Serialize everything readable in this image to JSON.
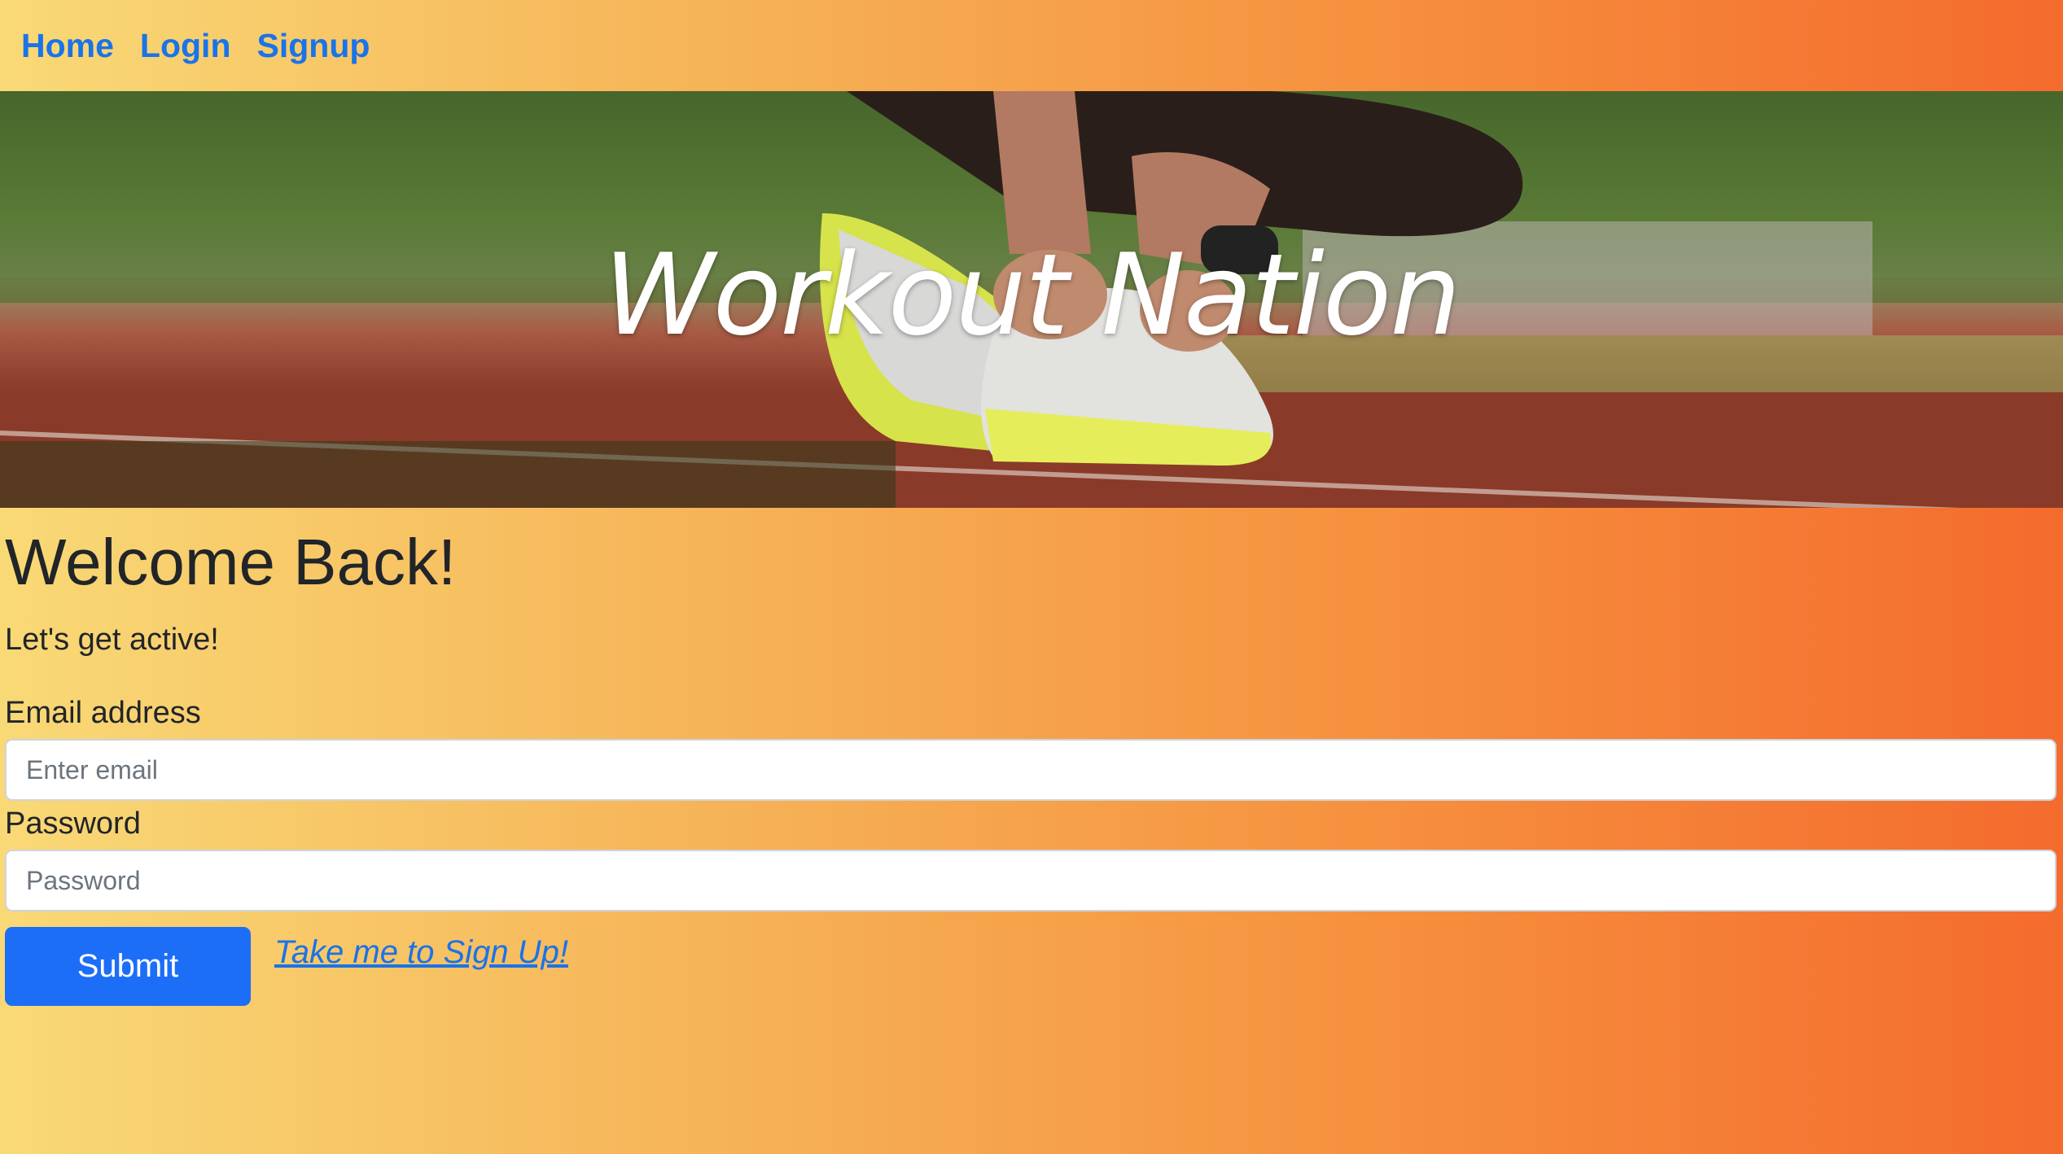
{
  "nav": {
    "items": [
      {
        "label": "Home"
      },
      {
        "label": "Login"
      },
      {
        "label": "Signup"
      }
    ]
  },
  "hero": {
    "title": "Workout Nation",
    "image_subject": "runner tying running shoes on a red track"
  },
  "main": {
    "heading": "Welcome Back!",
    "subheading": "Let's get active!"
  },
  "form": {
    "email_label": "Email address",
    "email_placeholder": "Enter email",
    "email_value": "",
    "password_label": "Password",
    "password_placeholder": "Password",
    "password_value": "",
    "submit_label": "Submit",
    "signup_link": "Take me to Sign Up!"
  },
  "colors": {
    "link": "#1a73e8",
    "button": "#1d6ef7",
    "gradient_start": "#f9d976",
    "gradient_end": "#f46b2d"
  }
}
